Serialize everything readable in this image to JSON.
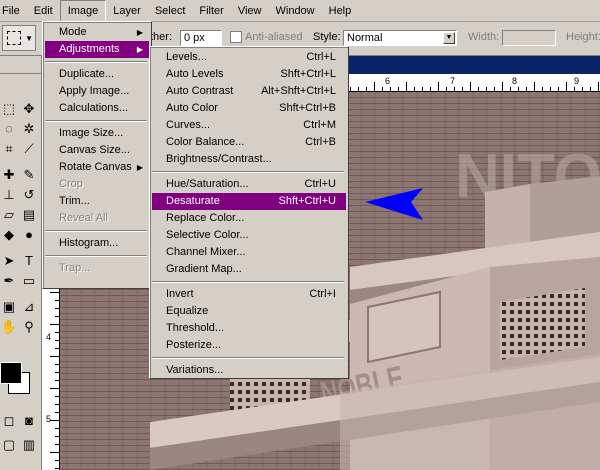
{
  "menubar": {
    "items": [
      "File",
      "Edit",
      "Image",
      "Layer",
      "Select",
      "Filter",
      "View",
      "Window",
      "Help"
    ],
    "active": "Image"
  },
  "options": {
    "feather_label": "ther:",
    "feather_value": "0 px",
    "antialiased_label": "Anti-aliased",
    "style_label": "Style:",
    "style_value": "Normal",
    "width_label": "Width:",
    "height_label": "Height:"
  },
  "image_menu": {
    "items": [
      {
        "label": "Mode",
        "submenu": true
      },
      {
        "label": "Adjustments",
        "submenu": true,
        "selected": true
      },
      {
        "sep": true
      },
      {
        "label": "Duplicate..."
      },
      {
        "label": "Apply Image..."
      },
      {
        "label": "Calculations..."
      },
      {
        "sep": true
      },
      {
        "label": "Image Size..."
      },
      {
        "label": "Canvas Size..."
      },
      {
        "label": "Rotate Canvas",
        "submenu": true
      },
      {
        "label": "Crop",
        "disabled": true
      },
      {
        "label": "Trim..."
      },
      {
        "label": "Reveal All",
        "disabled": true
      },
      {
        "sep": true
      },
      {
        "label": "Histogram..."
      },
      {
        "sep": true
      },
      {
        "label": "Trap...",
        "disabled": true
      }
    ]
  },
  "adjustments_menu": {
    "items": [
      {
        "label": "Levels...",
        "shortcut": "Ctrl+L"
      },
      {
        "label": "Auto Levels",
        "shortcut": "Shft+Ctrl+L"
      },
      {
        "label": "Auto Contrast",
        "shortcut": "Alt+Shft+Ctrl+L"
      },
      {
        "label": "Auto Color",
        "shortcut": "Shft+Ctrl+B"
      },
      {
        "label": "Curves...",
        "shortcut": "Ctrl+M"
      },
      {
        "label": "Color Balance...",
        "shortcut": "Ctrl+B"
      },
      {
        "label": "Brightness/Contrast...",
        "shortcut": ""
      },
      {
        "sep": true
      },
      {
        "label": "Hue/Saturation...",
        "shortcut": "Ctrl+U"
      },
      {
        "label": "Desaturate",
        "shortcut": "Shft+Ctrl+U",
        "selected": true
      },
      {
        "label": "Replace Color...",
        "shortcut": ""
      },
      {
        "label": "Selective Color...",
        "shortcut": ""
      },
      {
        "label": "Channel Mixer...",
        "shortcut": ""
      },
      {
        "label": "Gradient Map...",
        "shortcut": ""
      },
      {
        "sep": true
      },
      {
        "label": "Invert",
        "shortcut": "Ctrl+I"
      },
      {
        "label": "Equalize",
        "shortcut": ""
      },
      {
        "label": "Threshold...",
        "shortcut": ""
      },
      {
        "label": "Posterize...",
        "shortcut": ""
      },
      {
        "sep": true
      },
      {
        "label": "Variations...",
        "shortcut": ""
      }
    ]
  },
  "ruler": {
    "h_numbers": [
      "6",
      "7",
      "8",
      "9",
      "10"
    ],
    "v_numbers": [
      "4",
      "5"
    ]
  },
  "photo": {
    "sign_text": "NOBLE",
    "wall_text": "NITO"
  },
  "colors": {
    "menu_highlight": "#800080",
    "annotation_arrow": "#0000ff",
    "title_bar": "#0a246a"
  }
}
